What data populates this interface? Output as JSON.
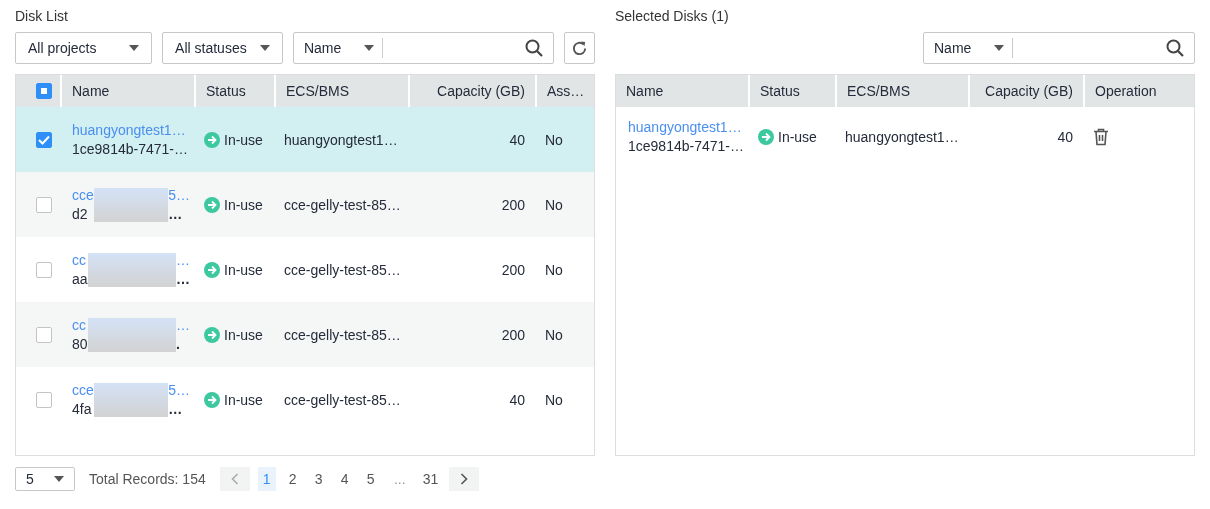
{
  "disk_list": {
    "title": "Disk List",
    "filters": [
      "All projects",
      "All statuses"
    ],
    "search": {
      "field": "Name"
    },
    "header_checkbox": {
      "indeterminate": true
    },
    "columns": [
      "Name",
      "Status",
      "ECS/BMS",
      "Capacity (GB)",
      "Ass…"
    ],
    "rows": [
      {
        "checked": true,
        "name_start": "huangyongtest1…",
        "id_start": "1ce9814b-7471-…",
        "status": "In-use",
        "ecs": "huangyongtest1…",
        "capacity": "40",
        "attached": "No"
      },
      {
        "checked": false,
        "name_start": "cce",
        "name_end": "5…",
        "id_start": "d2",
        "id_end": "…",
        "status": "In-use",
        "ecs": "cce-gelly-test-85…",
        "capacity": "200",
        "attached": "No"
      },
      {
        "checked": false,
        "name_start": "cc",
        "name_end": "…",
        "id_start": "aa",
        "id_end": "…",
        "status": "In-use",
        "ecs": "cce-gelly-test-85…",
        "capacity": "200",
        "attached": "No"
      },
      {
        "checked": false,
        "name_start": "cc",
        "name_end": "…",
        "id_start": "80",
        "id_end": ".",
        "status": "In-use",
        "ecs": "cce-gelly-test-85…",
        "capacity": "200",
        "attached": "No"
      },
      {
        "checked": false,
        "name_start": "cce",
        "name_end": "5…",
        "id_start": "4fa",
        "id_end": "…",
        "status": "In-use",
        "ecs": "cce-gelly-test-85…",
        "capacity": "40",
        "attached": "No"
      }
    ],
    "pagination": {
      "page_size": "5",
      "total": "Total Records: 154",
      "pages": [
        {
          "kind": "page",
          "label": "1",
          "selected": true
        },
        {
          "kind": "page",
          "label": "2",
          "selected": false
        },
        {
          "kind": "page",
          "label": "3",
          "selected": false
        },
        {
          "kind": "page",
          "label": "4",
          "selected": false
        },
        {
          "kind": "page",
          "label": "5",
          "selected": false
        },
        {
          "kind": "ellipsis",
          "label": "..."
        },
        {
          "kind": "page",
          "label": "31",
          "selected": false
        }
      ]
    }
  },
  "selected_disks": {
    "title": "Selected Disks (1)",
    "search": {
      "field": "Name"
    },
    "columns": [
      "Name",
      "Status",
      "ECS/BMS",
      "Capacity (GB)",
      "Operation"
    ],
    "rows": [
      {
        "name": "huangyongtest1…",
        "id": "1ce9814b-7471-…",
        "status": "In-use",
        "ecs": "huangyongtest1…",
        "capacity": "40"
      }
    ]
  }
}
